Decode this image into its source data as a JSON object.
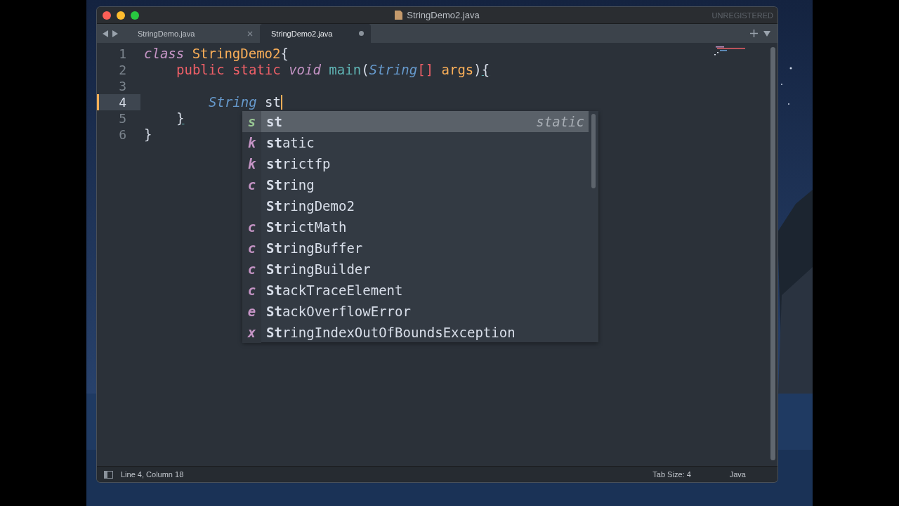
{
  "window": {
    "title": "StringDemo2.java",
    "registration": "UNREGISTERED"
  },
  "tabs": [
    {
      "label": "StringDemo.java",
      "selected": false,
      "modified": false
    },
    {
      "label": "StringDemo2.java",
      "selected": true,
      "modified": true
    }
  ],
  "code": [
    {
      "number": "1",
      "current": false,
      "tokens": [
        {
          "text": "class",
          "kind": "storage"
        },
        {
          "text": " StringDemo2",
          "kind": "entity"
        },
        {
          "text": "{",
          "kind": "plain"
        }
      ],
      "children": [
        {
          "number": "2",
          "current": false,
          "tokens": [
            {
              "text": "public",
              "kind": "keyword"
            },
            {
              "text": " static",
              "kind": "keyword"
            },
            {
              "text": " void",
              "kind": "storage"
            },
            {
              "text": " main",
              "kind": "function"
            },
            {
              "text": "(",
              "kind": "plain"
            },
            {
              "text": "String",
              "kind": "type"
            },
            {
              "text": "[]",
              "kind": "keyword"
            },
            {
              "text": " args",
              "kind": "param"
            },
            {
              "text": ")",
              "kind": "plain"
            },
            {
              "text": "{",
              "kind": "bracket"
            }
          ],
          "children": [
            {
              "number": "3",
              "current": false
            },
            {
              "number": "4",
              "current": true,
              "tokens": [
                {
                  "text": "String",
                  "kind": "type"
                },
                {
                  "text": " st",
                  "kind": "plain"
                }
              ]
            }
          ]
        },
        {
          "number": "5",
          "current": false,
          "tokens": [
            {
              "text": "}",
              "kind": "bracket"
            }
          ]
        }
      ]
    },
    {
      "number": "6",
      "current": false,
      "tokens": [
        {
          "text": "}",
          "kind": "plain"
        }
      ]
    }
  ],
  "completions": [
    {
      "letter": "s",
      "kind": "snippet",
      "label": "**st**",
      "hint": "static",
      "selected": true
    },
    {
      "letter": "k",
      "kind": "keyword",
      "label": "**st**atic",
      "selected": false
    },
    {
      "letter": "k",
      "kind": "keyword",
      "label": "**st**rictfp",
      "selected": false
    },
    {
      "letter": "c",
      "kind": "class",
      "label": "**St**ring",
      "selected": false
    },
    {
      "kind": "word",
      "label": "**St**ringDemo2",
      "selected": false
    },
    {
      "letter": "c",
      "kind": "class",
      "label": "**St**rictMath",
      "selected": false
    },
    {
      "letter": "c",
      "kind": "class",
      "label": "**St**ringBuffer",
      "selected": false
    },
    {
      "letter": "c",
      "kind": "class",
      "label": "**St**ringBuilder",
      "selected": false
    },
    {
      "letter": "c",
      "kind": "class",
      "label": "**St**ackTraceElement",
      "selected": false
    },
    {
      "letter": "e",
      "kind": "error",
      "label": "**St**ackOverflowError",
      "selected": false
    },
    {
      "letter": "x",
      "kind": "exception",
      "label": "**St**ringIndexOutOfBoundsException",
      "selected": false
    }
  ],
  "status_bar": {
    "position": "Line 4, Column 18",
    "tab_size": "Tab Size: 4",
    "syntax": "Java"
  }
}
